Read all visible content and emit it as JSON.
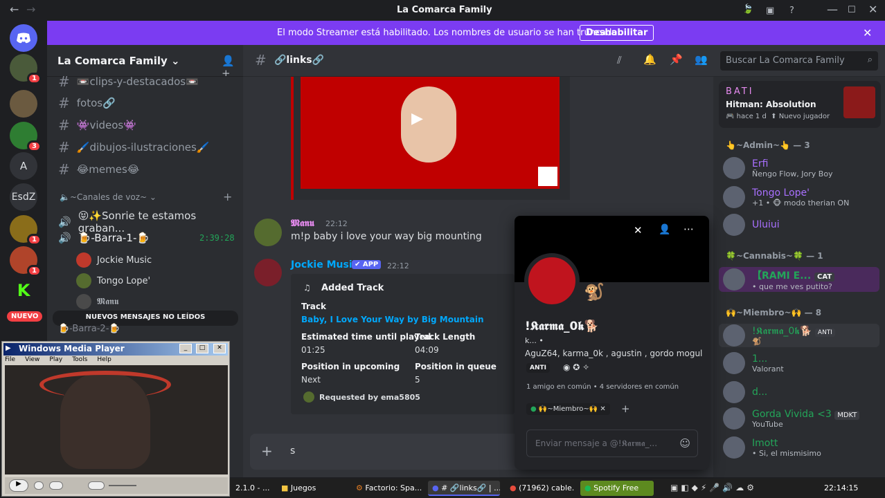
{
  "window": {
    "title": "La Comarca Family"
  },
  "banner": {
    "text": "El modo Streamer está habilitado. Los nombres de usuario se han truncado.",
    "button": "Deshabilitar"
  },
  "guilds": [
    {
      "badge": "1"
    },
    {
      "badge": ""
    },
    {
      "badge": "3"
    },
    {
      "label": "A"
    },
    {
      "label": "EsdZ"
    },
    {
      "badge": "1"
    },
    {
      "badge": "1"
    },
    {
      "label": "K"
    },
    {
      "label": "NUEVO"
    }
  ],
  "server": {
    "name": "La Comarca Family"
  },
  "channels": {
    "text": [
      "📼clips-y-destacados📼",
      "fotos🔗",
      "👾videos👾",
      "🖌️dibujos-ilustraciones🖌️",
      "😂memes😂"
    ],
    "voice_category": "~Canales de voz~",
    "voice": [
      {
        "name": "😝✨Sonrie te estamos graban..."
      },
      {
        "name": "🍺-Barra-1-🍺",
        "timer": "2:39:28"
      }
    ],
    "voice_users": [
      "Jockie Music",
      "Tongo Lope'",
      "𝕸𝖆𝖓𝖚"
    ],
    "new_messages": "NUEVOS MENSAJES NO LEÍDOS",
    "partial": "🍺-Barra-2-🍺"
  },
  "channel_header": {
    "name": "🔗links🔗"
  },
  "search": {
    "placeholder": "Buscar La Comarca Family"
  },
  "messages": [
    {
      "author": "𝕸𝖆𝖓𝖚",
      "time": "22:12",
      "text": "m!p baby i love your way big mounting"
    },
    {
      "author": "Jockie Music",
      "badge": "✔ APP",
      "time": "22:12",
      "embed": {
        "title": "Added Track",
        "track_label": "Track",
        "track": "Baby, I Love Your Way by Big Mountain",
        "est_label": "Estimated time until played",
        "est": "01:25",
        "len_label": "Track Length",
        "len": "04:09",
        "pos_label": "Position in upcoming",
        "pos": "Next",
        "q_label": "Position in queue",
        "q": "5",
        "footer": "Requested by ema5805"
      }
    }
  ],
  "composer": {
    "text": "s"
  },
  "popup": {
    "name": "!𝕶𝖆𝖗𝖒𝖆_0𝖐🐕",
    "tag": "k... •",
    "aliases": "AguZ64, karma_0k , agustin , gordo mogul",
    "badge": "ANTI",
    "mutual": "1 amigo en común • 4 servidores en común",
    "role": "🙌~Miembro~🙌",
    "placeholder": "Enviar mensaje a @!𝕶𝖆𝖗𝖒𝖆_..."
  },
  "activity": {
    "user": "BATI",
    "game": "Hitman: Absolution",
    "ago": "hace 1 d",
    "status": "Nuevo jugador"
  },
  "member_groups": [
    {
      "title": "👆~Admin~👆 — 3",
      "members": [
        {
          "name": "Erfi",
          "sub": "Ñengo Flow, Jory Boy",
          "color": "#a970ff"
        },
        {
          "name": "Tongo Lope'",
          "sub": "+1 • 🐵 modo therian ON",
          "color": "#a970ff"
        },
        {
          "name": "Uluiui",
          "sub": "",
          "color": "#a970ff"
        }
      ]
    },
    {
      "title": "🍀~Cannabis~🍀 — 1",
      "members": [
        {
          "name": "【RAMI E...",
          "sub": "• que me ves putito?",
          "color": "#23a559",
          "tag": "CAT"
        }
      ]
    },
    {
      "title": "🙌~Miembro~🙌 — 8",
      "members": [
        {
          "name": "!𝕶𝖆𝖗𝖒𝖆_0𝖐🐕",
          "sub": "🐒",
          "color": "#23a559",
          "tag": "ANTI"
        },
        {
          "name": "1...",
          "sub": "Valorant",
          "color": "#23a559"
        },
        {
          "name": "d...",
          "sub": "",
          "color": "#23a559"
        },
        {
          "name": "Gorda Vivida <3",
          "sub": "YouTube",
          "color": "#23a559",
          "tag": "MDKT"
        },
        {
          "name": "Imott",
          "sub": "• Si, el mismisimo",
          "color": "#23a559"
        }
      ]
    }
  ],
  "wmp": {
    "title": "Windows Media Player",
    "menu": [
      "File",
      "View",
      "Play",
      "Tools",
      "Help"
    ]
  },
  "taskbar": {
    "items": [
      "2.1.0 - ...",
      "Juegos",
      "Factorio: Spa...",
      "# 🔗links🔗 | ...",
      "(71962) cable...",
      "Spotify Free"
    ],
    "clock": "22:14:15"
  },
  "colors": {
    "accent": "#5865f2",
    "banner": "#7b3cf2",
    "online": "#23a559",
    "danger": "#f23f43",
    "embed_bg": "#2b2d31",
    "link": "#00a8fc"
  }
}
